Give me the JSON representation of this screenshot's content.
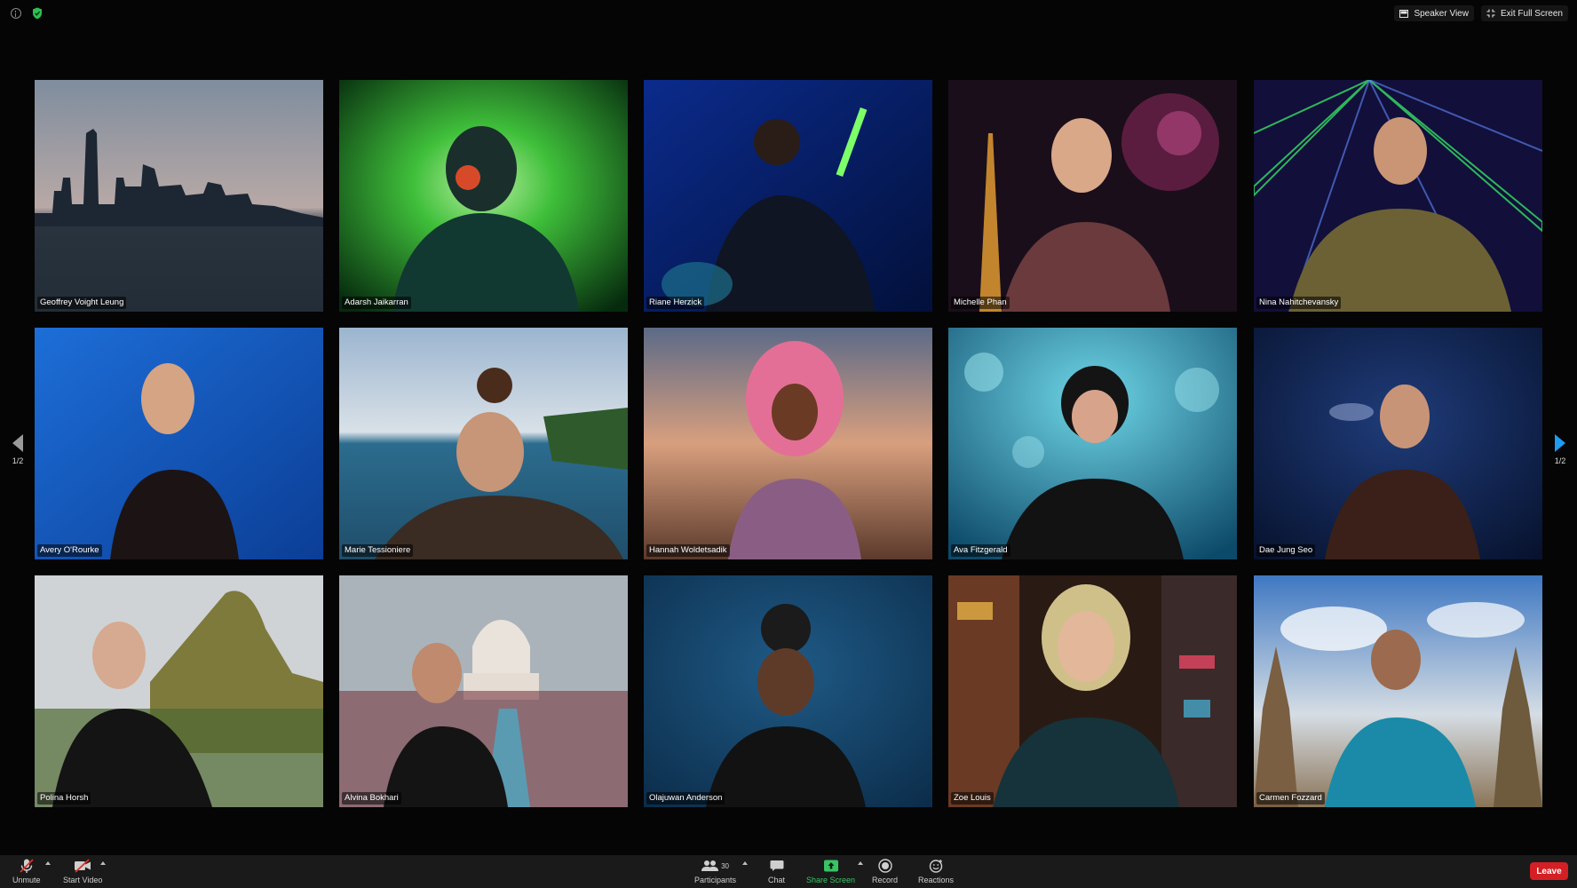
{
  "topbar": {
    "speaker_view_label": "Speaker View",
    "exit_full_screen_label": "Exit Full Screen"
  },
  "pagination": {
    "left_label": "1/2",
    "right_label": "1/2"
  },
  "participants": [
    {
      "name": "Geoffrey Voight Leung",
      "scene": "city-skyline"
    },
    {
      "name": "Adarsh Jaikarran",
      "scene": "green-light-streaks"
    },
    {
      "name": "Riane Herzick",
      "scene": "blue-neon-stage"
    },
    {
      "name": "Michelle Phan",
      "scene": "eiffel-fireworks"
    },
    {
      "name": "Nina Nahitchevansky",
      "scene": "laser-show"
    },
    {
      "name": "Avery O'Rourke",
      "scene": "blue-studio"
    },
    {
      "name": "Marie Tessioniere",
      "scene": "beach-coast"
    },
    {
      "name": "Hannah Woldetsadik",
      "scene": "sunset-fair"
    },
    {
      "name": "Ava Fitzgerald",
      "scene": "jellyfish-aquarium"
    },
    {
      "name": "Dae Jung Seo",
      "scene": "dark-blue-studio"
    },
    {
      "name": "Polina Horsh",
      "scene": "mountain-landscape"
    },
    {
      "name": "Alvina Bokhari",
      "scene": "taj-mahal"
    },
    {
      "name": "Olajuwan Anderson",
      "scene": "blue-backdrop"
    },
    {
      "name": "Zoe Louis",
      "scene": "neon-street"
    },
    {
      "name": "Carmen Fozzard",
      "scene": "ancient-ruins-sky"
    }
  ],
  "toolbar": {
    "unmute_label": "Unmute",
    "start_video_label": "Start Video",
    "participants_label": "Participants",
    "participants_count": "30",
    "chat_label": "Chat",
    "share_screen_label": "Share Screen",
    "record_label": "Record",
    "reactions_label": "Reactions",
    "leave_label": "Leave"
  },
  "colors": {
    "leave": "#d41f24",
    "share_screen": "#38c464",
    "nav_arrow_active": "#1e9cf0",
    "toolbar_bg": "#1a1a1a"
  }
}
